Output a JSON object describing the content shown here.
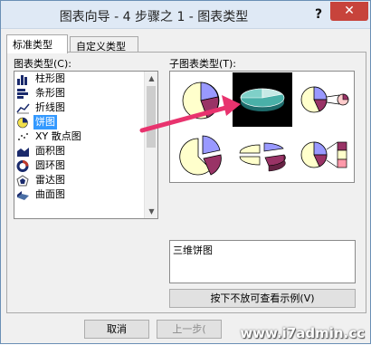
{
  "window": {
    "title": "图表向导 - 4 步骤之 1 - 图表类型",
    "help": "?",
    "close": "✕"
  },
  "tabs": [
    {
      "label": "标准类型"
    },
    {
      "label": "自定义类型"
    }
  ],
  "chart_type_label": "图表类型(C):",
  "chart_types": [
    {
      "label": "柱形图",
      "icon": "column-chart-icon"
    },
    {
      "label": "条形图",
      "icon": "bar-chart-icon"
    },
    {
      "label": "折线图",
      "icon": "line-chart-icon"
    },
    {
      "label": "饼图",
      "icon": "pie-chart-icon",
      "selected": true
    },
    {
      "label": "XY 散点图",
      "icon": "scatter-chart-icon"
    },
    {
      "label": "面积图",
      "icon": "area-chart-icon"
    },
    {
      "label": "圆环图",
      "icon": "doughnut-chart-icon"
    },
    {
      "label": "雷达图",
      "icon": "radar-chart-icon"
    },
    {
      "label": "曲面图",
      "icon": "surface-chart-icon"
    }
  ],
  "subtype_label": "子图表类型(T):",
  "subtypes": [
    {
      "name": "pie",
      "selected": false
    },
    {
      "name": "3d-pie",
      "selected": true
    },
    {
      "name": "pie-of-pie",
      "selected": false
    },
    {
      "name": "exploded-pie",
      "selected": false
    },
    {
      "name": "exploded-3d-pie",
      "selected": false
    },
    {
      "name": "bar-of-pie",
      "selected": false
    }
  ],
  "description": "三维饼图",
  "preview_button": "按下不放可查看示例(V)",
  "footer": {
    "cancel": "取消",
    "back": "上一步("
  },
  "watermark": "www.i7admin.cc",
  "colors": {
    "accent": "#3399ff",
    "arrow": "#e8336e",
    "pie_blue": "#9999ff",
    "pie_maroon": "#993366",
    "pie_cream": "#ffffcc",
    "pie_teal": "#2e8b8b"
  }
}
